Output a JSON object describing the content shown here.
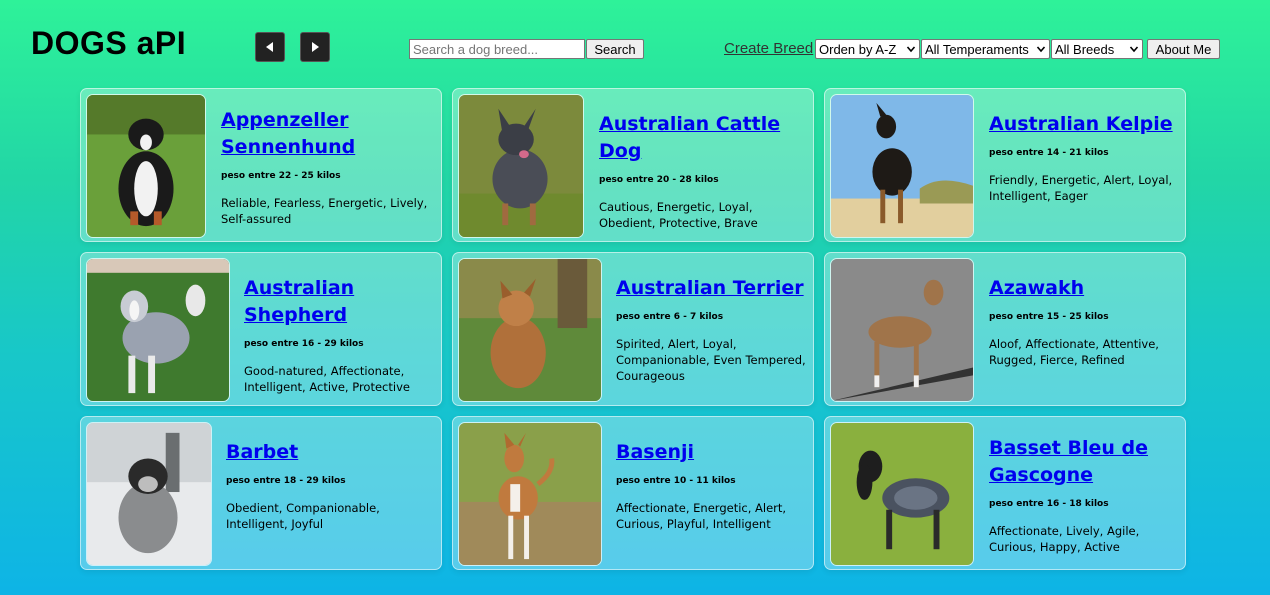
{
  "header": {
    "title": "DOGS aPI",
    "search_placeholder": "Search a dog breed...",
    "search_label": "Search",
    "create_label": "Create Breed",
    "order_selected": "Orden by A-Z",
    "temperament_selected": "All Temperaments",
    "breeds_selected": "All Breeds",
    "about_label": "About Me"
  },
  "cards": [
    {
      "name": "Appenzeller Sennenhund",
      "weight": "peso entre 22 - 25 kilos",
      "temperament": "Reliable, Fearless, Energetic, Lively, Self-assured"
    },
    {
      "name": "Australian Cattle Dog",
      "weight": "peso entre 20 - 28 kilos",
      "temperament": "Cautious, Energetic, Loyal, Obedient, Protective, Brave"
    },
    {
      "name": "Australian Kelpie",
      "weight": "peso entre 14 - 21 kilos",
      "temperament": "Friendly, Energetic, Alert, Loyal, Intelligent, Eager"
    },
    {
      "name": "Australian Shepherd",
      "weight": "peso entre 16 - 29 kilos",
      "temperament": "Good-natured, Affectionate, Intelligent, Active, Protective"
    },
    {
      "name": "Australian Terrier",
      "weight": "peso entre 6 - 7 kilos",
      "temperament": "Spirited, Alert, Loyal, Companionable, Even Tempered, Courageous"
    },
    {
      "name": "Azawakh",
      "weight": "peso entre 15 - 25 kilos",
      "temperament": "Aloof, Affectionate, Attentive, Rugged, Fierce, Refined"
    },
    {
      "name": "Barbet",
      "weight": "peso entre 18 - 29 kilos",
      "temperament": "Obedient, Companionable, Intelligent, Joyful"
    },
    {
      "name": "Basenji",
      "weight": "peso entre 10 - 11 kilos",
      "temperament": "Affectionate, Energetic, Alert, Curious, Playful, Intelligent"
    },
    {
      "name": "Basset Bleu de Gascogne",
      "weight": "peso entre 16 - 18 kilos",
      "temperament": "Affectionate, Lively, Agile, Curious, Happy, Active"
    }
  ]
}
